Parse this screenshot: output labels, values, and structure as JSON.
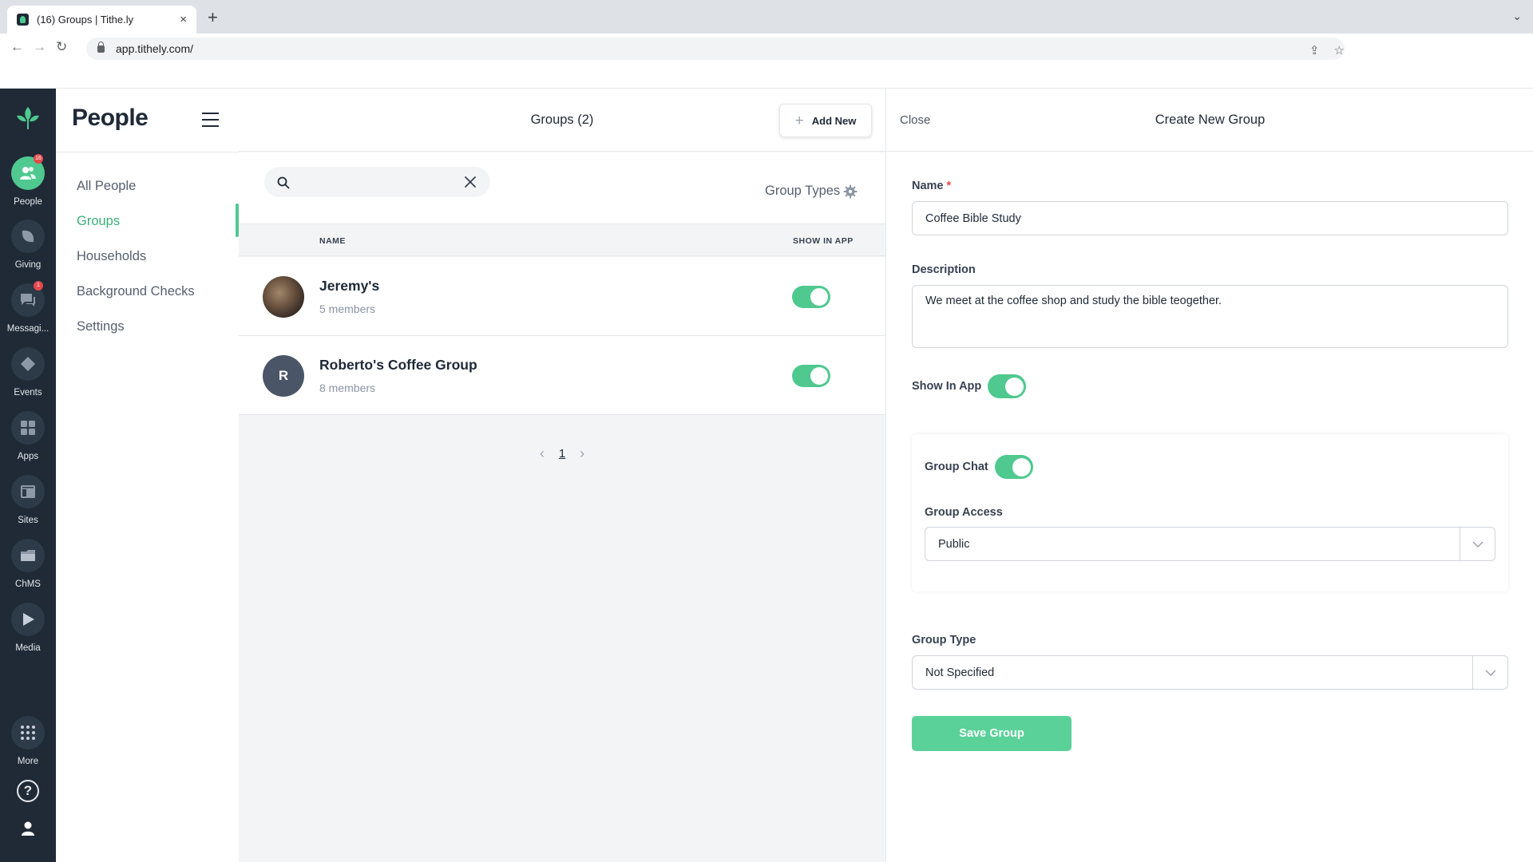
{
  "browser": {
    "tab_title": "(16) Groups | Tithe.ly",
    "tab_close": "×",
    "new_tab": "+",
    "url": "app.tithely.com/"
  },
  "rail": {
    "items": [
      {
        "label": "People",
        "icon": "people-icon",
        "badge": "16"
      },
      {
        "label": "Giving",
        "icon": "giving-icon"
      },
      {
        "label": "Messagi...",
        "icon": "messaging-icon",
        "badge": "1"
      },
      {
        "label": "Events",
        "icon": "events-icon"
      },
      {
        "label": "Apps",
        "icon": "apps-icon"
      },
      {
        "label": "Sites",
        "icon": "sites-icon"
      },
      {
        "label": "ChMS",
        "icon": "chms-icon"
      },
      {
        "label": "Media",
        "icon": "media-icon"
      },
      {
        "label": "More",
        "icon": "more-icon"
      }
    ],
    "help": "?",
    "accent": "#4fc98f",
    "background": "#1f2a36"
  },
  "sidebar": {
    "title": "People",
    "items": [
      {
        "label": "All People"
      },
      {
        "label": "Groups",
        "active": true
      },
      {
        "label": "Households"
      },
      {
        "label": "Background Checks"
      },
      {
        "label": "Settings"
      }
    ]
  },
  "main": {
    "title": "Groups (2)",
    "add_new": "Add New",
    "search": {
      "value": "",
      "placeholder": ""
    },
    "group_types": "Group Types",
    "columns": {
      "name": "NAME",
      "show_in_app": "SHOW IN APP"
    },
    "rows": [
      {
        "name": "Jeremy's",
        "members": "5 members",
        "avatar": "photo",
        "show_in_app": true
      },
      {
        "name": "Roberto's Coffee Group",
        "members": "8 members",
        "avatar_initial": "R",
        "show_in_app": true
      }
    ],
    "pagination": {
      "page": "1"
    }
  },
  "panel": {
    "close": "Close",
    "title": "Create New Group",
    "name_label": "Name",
    "required_mark": "*",
    "name_value": "Coffee Bible Study",
    "description_label": "Description",
    "description_value": "We meet at the coffee shop and study the bible teogether.",
    "show_in_app_label": "Show In App",
    "show_in_app": true,
    "group_chat_label": "Group Chat",
    "group_chat": true,
    "group_access_label": "Group Access",
    "group_access_value": "Public",
    "group_type_label": "Group Type",
    "group_type_value": "Not Specified",
    "save_label": "Save Group"
  }
}
